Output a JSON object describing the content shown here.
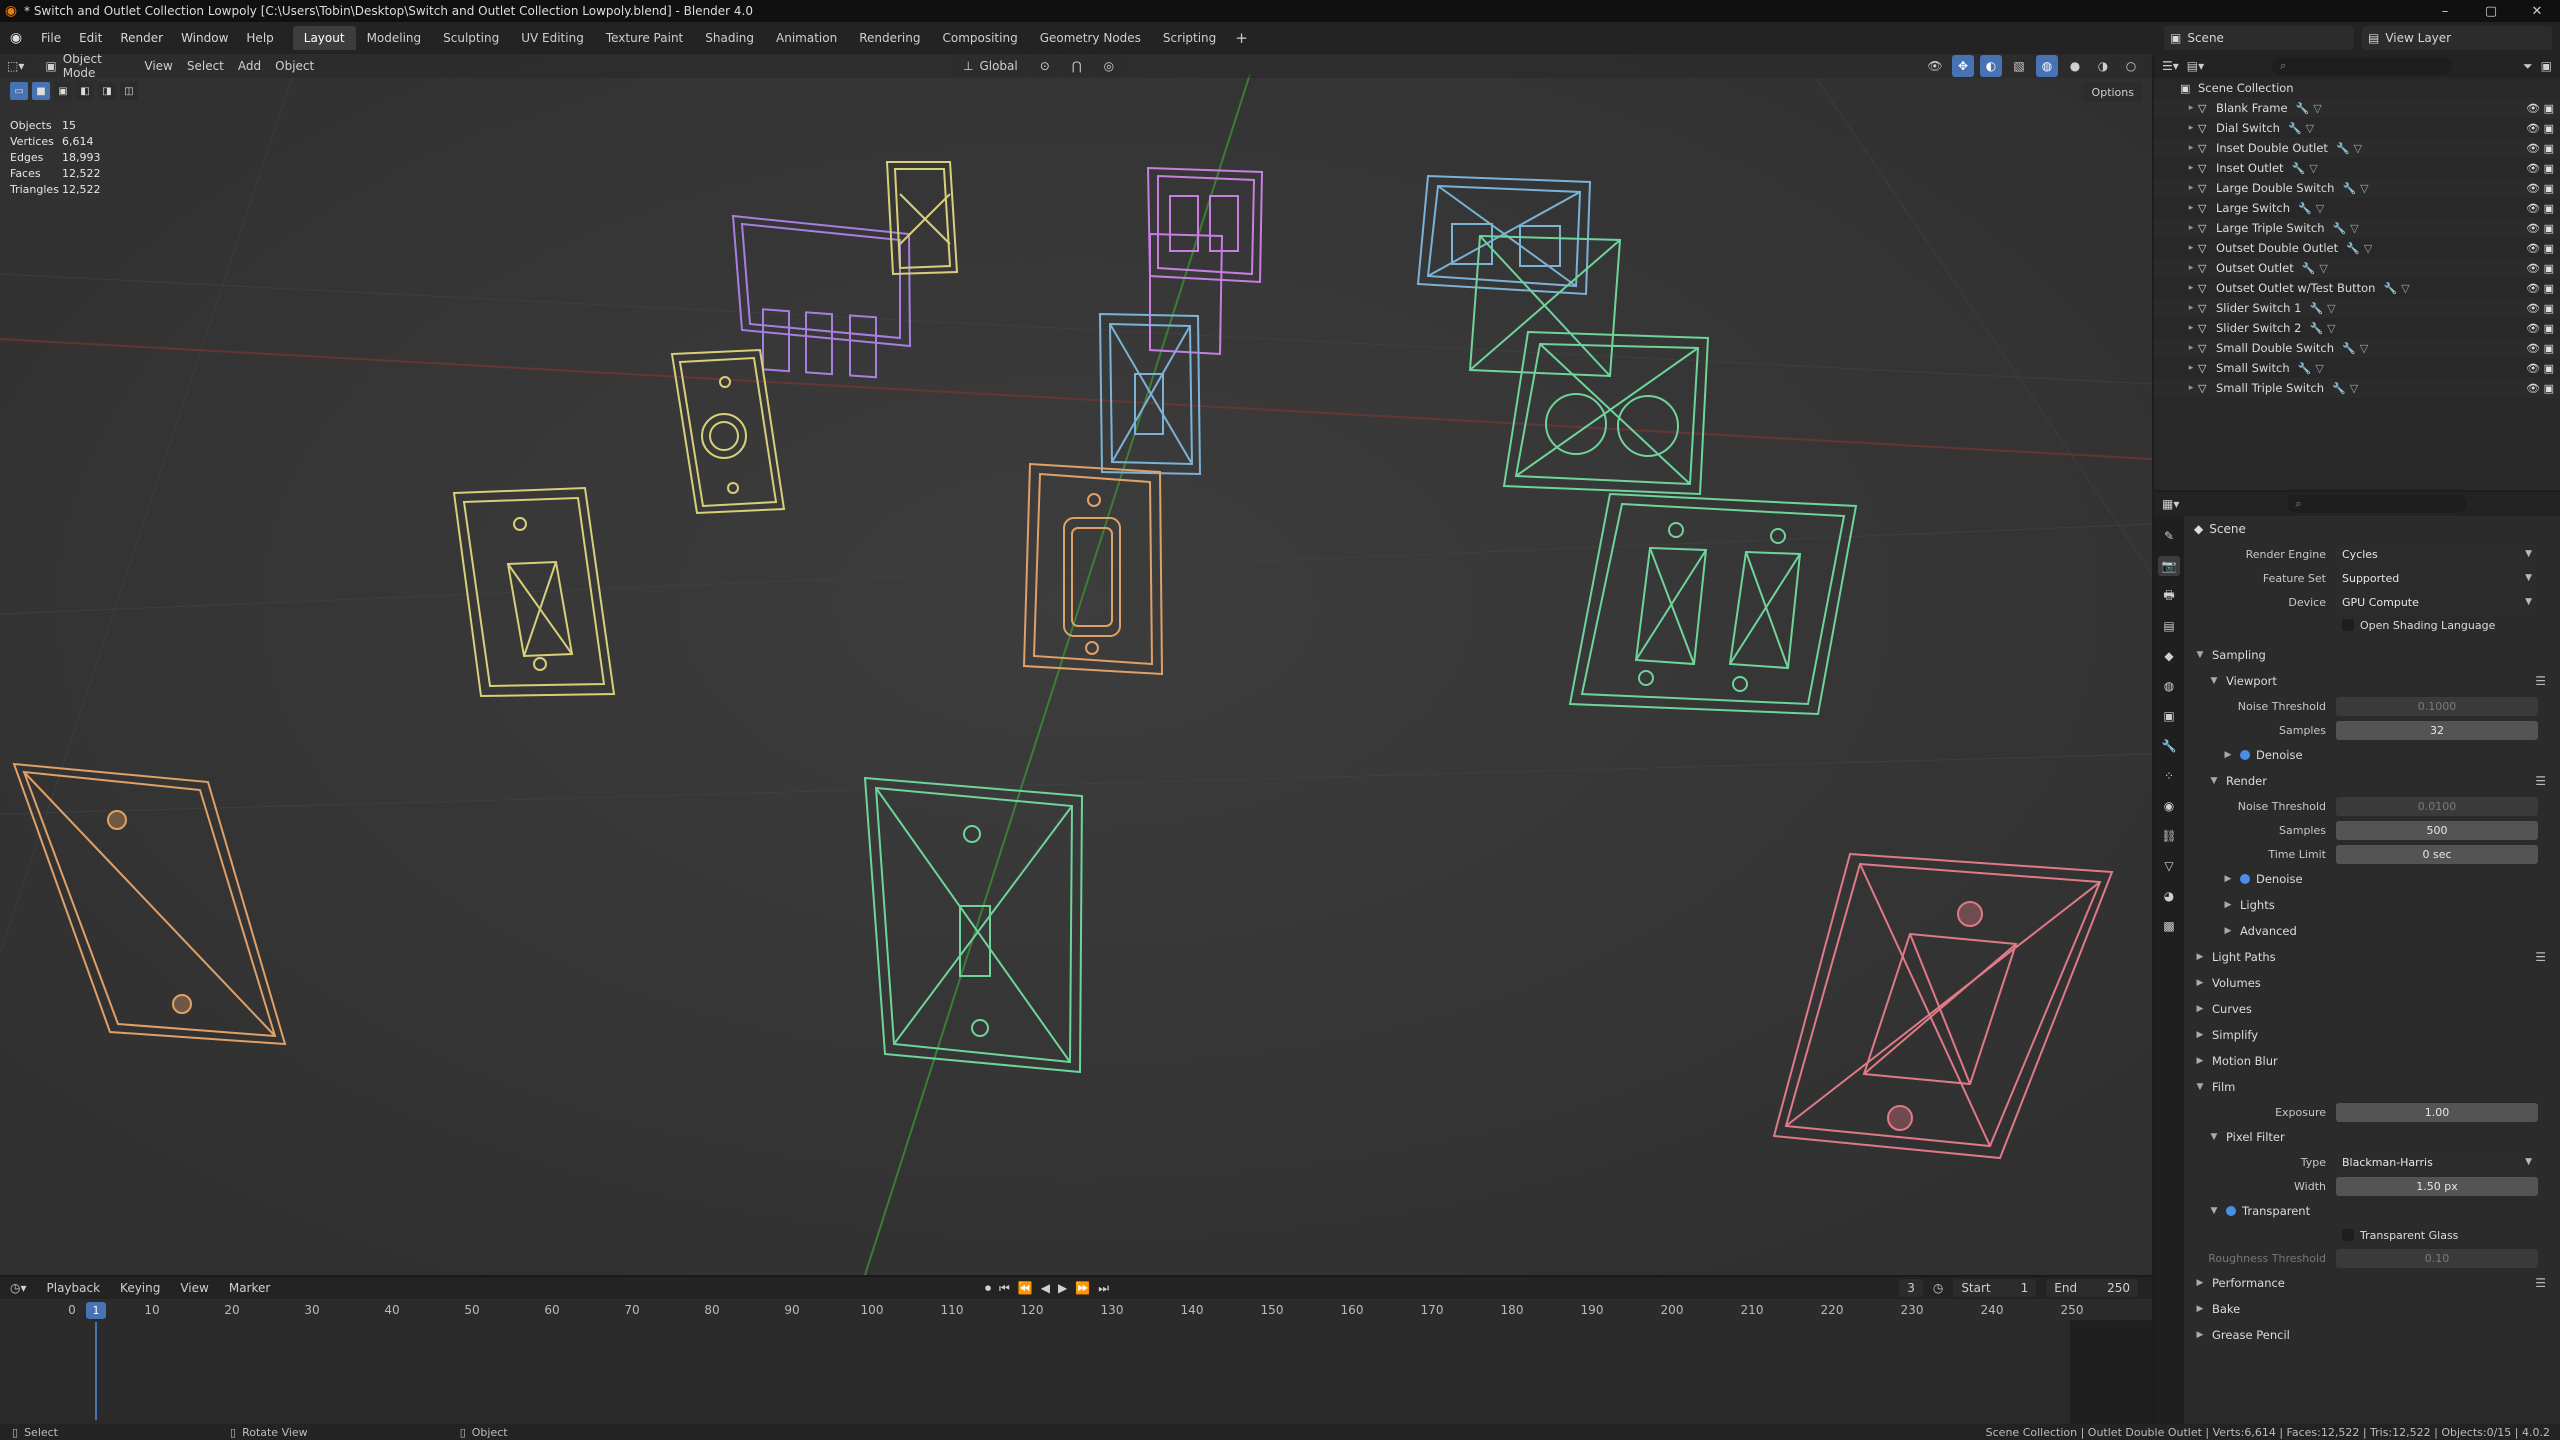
{
  "titlebar": {
    "title": "* Switch and Outlet Collection Lowpoly [C:\\Users\\Tobin\\Desktop\\Switch and Outlet Collection Lowpoly.blend] - Blender 4.0",
    "minimize": "–",
    "maximize": "▢",
    "close": "✕"
  },
  "menu": {
    "items": [
      "File",
      "Edit",
      "Render",
      "Window",
      "Help"
    ],
    "workspaces": [
      "Layout",
      "Modeling",
      "Sculpting",
      "UV Editing",
      "Texture Paint",
      "Shading",
      "Animation",
      "Rendering",
      "Compositing",
      "Geometry Nodes",
      "Scripting"
    ],
    "active_workspace": "Layout",
    "add": "+",
    "scene": "Scene",
    "view_layer": "View Layer"
  },
  "viewport": {
    "mode": "Object Mode",
    "menus": [
      "View",
      "Select",
      "Add",
      "Object"
    ],
    "orientation": "Global",
    "options": "Options",
    "stats": [
      {
        "label": "Objects",
        "value": "15"
      },
      {
        "label": "Vertices",
        "value": "6,614"
      },
      {
        "label": "Edges",
        "value": "18,993"
      },
      {
        "label": "Faces",
        "value": "12,522"
      },
      {
        "label": "Triangles",
        "value": "12,522"
      }
    ]
  },
  "timeline": {
    "menus": [
      "Playback",
      "Keying",
      "View",
      "Marker"
    ],
    "current_frame": "3",
    "playhead_frame": "1",
    "start_label": "Start",
    "start": "1",
    "end_label": "End",
    "end": "250",
    "ticks": [
      "0",
      "10",
      "20",
      "30",
      "40",
      "50",
      "60",
      "70",
      "80",
      "90",
      "100",
      "110",
      "120",
      "130",
      "140",
      "150",
      "160",
      "170",
      "180",
      "190",
      "200",
      "210",
      "220",
      "230",
      "240",
      "250"
    ],
    "controls": [
      "⏺",
      "⏮",
      "⏪",
      "◀",
      "▶",
      "⏩",
      "⏭"
    ]
  },
  "statusbar": {
    "select": "Select",
    "rotate": "Rotate View",
    "object": "Object",
    "info": "Scene Collection | Outlet Double Outlet | Verts:6,614 | Faces:12,522 | Tris:12,522 | Objects:0/15 | 4.0.2"
  },
  "outliner": {
    "root": "Scene Collection",
    "objects": [
      "Blank Frame",
      "Dial Switch",
      "Inset Double Outlet",
      "Inset Outlet",
      "Large Double Switch",
      "Large Switch",
      "Large Triple Switch",
      "Outset Double Outlet",
      "Outset Outlet",
      "Outset Outlet w/Test Button",
      "Slider Switch 1",
      "Slider Switch 2",
      "Small Double Switch",
      "Small Switch",
      "Small Triple Switch"
    ]
  },
  "properties": {
    "context": "Scene",
    "render_engine_label": "Render Engine",
    "render_engine": "Cycles",
    "feature_set_label": "Feature Set",
    "feature_set": "Supported",
    "device_label": "Device",
    "device": "GPU Compute",
    "osl": "Open Shading Language",
    "sampling": "Sampling",
    "viewport": "Viewport",
    "noise_threshold_label": "Noise Threshold",
    "viewport_noise": "0.1000",
    "samples_label": "Samples",
    "viewport_samples": "32",
    "denoise": "Denoise",
    "render": "Render",
    "render_noise": "0.0100",
    "render_samples": "500",
    "time_limit_label": "Time Limit",
    "time_limit": "0 sec",
    "lights": "Lights",
    "advanced": "Advanced",
    "light_paths": "Light Paths",
    "volumes": "Volumes",
    "curves": "Curves",
    "simplify": "Simplify",
    "motion_blur": "Motion Blur",
    "film": "Film",
    "exposure_label": "Exposure",
    "exposure": "1.00",
    "pixel_filter": "Pixel Filter",
    "type_label": "Type",
    "filter_type": "Blackman-Harris",
    "width_label": "Width",
    "filter_width": "1.50 px",
    "transparent": "Transparent",
    "transparent_glass": "Transparent Glass",
    "roughness_label": "Roughness Threshold",
    "roughness": "0.10",
    "performance": "Performance",
    "bake": "Bake",
    "grease_pencil": "Grease Pencil"
  },
  "colors": {
    "accent": "#4772b3",
    "viewport_bg": "#393939",
    "wire_yellow": "#d8cf7a",
    "wire_purple": "#a87fe0",
    "wire_magenta": "#c77ee0",
    "wire_blue": "#7ab3d6",
    "wire_green": "#6fd49a",
    "wire_orange": "#e0a066",
    "wire_red": "#e07a86",
    "axis_red": "#8a3c3c",
    "axis_green": "#3c8a3c"
  }
}
